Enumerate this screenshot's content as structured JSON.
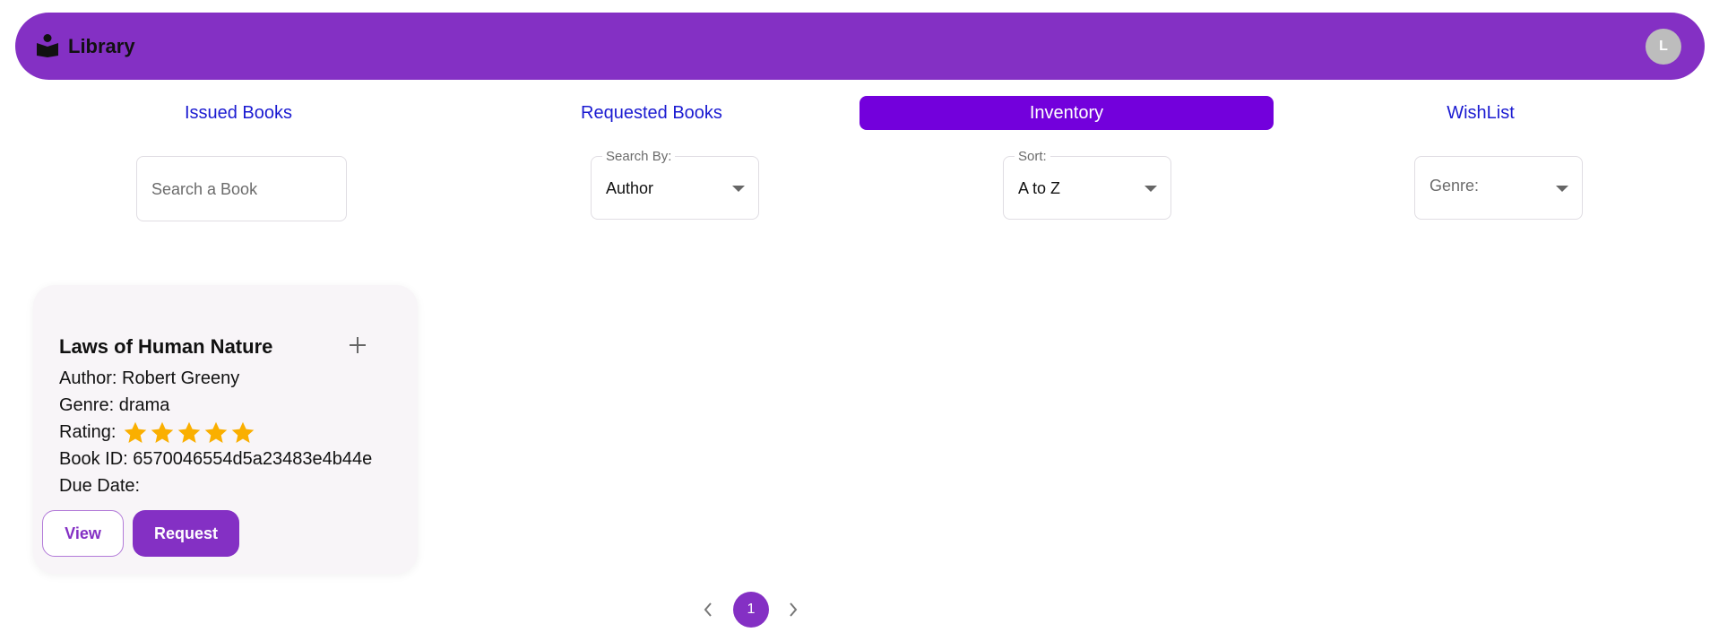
{
  "app": {
    "title": "Library",
    "logo_icon": "book-reader-icon",
    "avatar_initial": "L",
    "brand_color": "#8430c4"
  },
  "tabs": [
    {
      "label": "Issued Books",
      "active": false
    },
    {
      "label": "Requested Books",
      "active": false
    },
    {
      "label": "Inventory",
      "active": true
    },
    {
      "label": "WishList",
      "active": false
    }
  ],
  "filters": {
    "search": {
      "placeholder": "Search a Book",
      "value": ""
    },
    "search_by": {
      "label": "Search By:",
      "value": "Author"
    },
    "sort": {
      "label": "Sort:",
      "value": "A to Z"
    },
    "genre": {
      "placeholder": "Genre:",
      "value": ""
    }
  },
  "books": [
    {
      "title": "Laws of Human Nature",
      "author_line": "Author: Robert Greeny",
      "genre_line": "Genre: drama",
      "rating_label": "Rating:",
      "rating": 5,
      "rating_max": 5,
      "book_id_line": "Book ID: 6570046554d5a23483e4b44e",
      "due_date_line": "Due Date:",
      "view_label": "View",
      "request_label": "Request",
      "add_icon": "plus-icon"
    }
  ],
  "pagination": {
    "current_page": "1",
    "prev_icon": "chevron-left-icon",
    "next_icon": "chevron-right-icon"
  }
}
